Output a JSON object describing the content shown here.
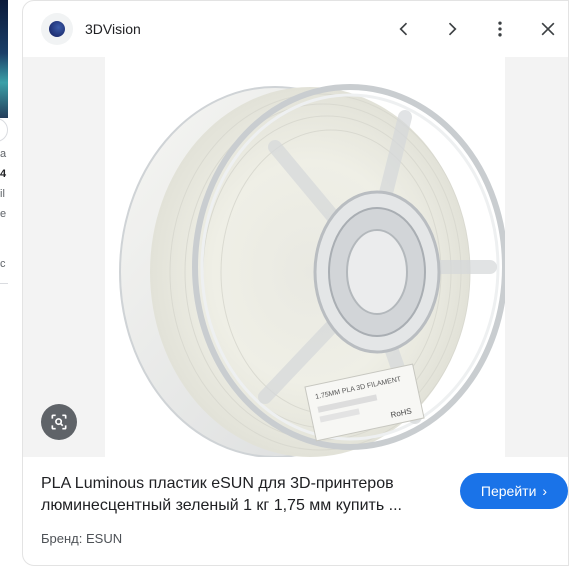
{
  "underlying_page": {
    "fragments": [
      "a",
      "4",
      "il",
      "e",
      "c"
    ]
  },
  "header": {
    "site_name": "3DVision",
    "icons": {
      "logo": "site-logo-icon",
      "prev": "chevron-left-icon",
      "next": "chevron-right-icon",
      "more": "more-vert-icon",
      "close": "close-icon"
    }
  },
  "image": {
    "product": "filament-spool",
    "label_text": "1.75MM PLA 3D FILAMENT",
    "rohs_text": "RoHS"
  },
  "lens": {
    "icon": "lens-search-icon"
  },
  "result": {
    "title": "PLA Luminous пластик eSUN для 3D-принтеров люминесцентный зеленый 1 кг 1,75 мм купить ...",
    "brand": "Бренд: ESUN",
    "button_label": "Перейти",
    "button_chevron": "›"
  },
  "colors": {
    "accent": "#1a73e8",
    "text": "#202124",
    "secondary_text": "#4d5156"
  }
}
